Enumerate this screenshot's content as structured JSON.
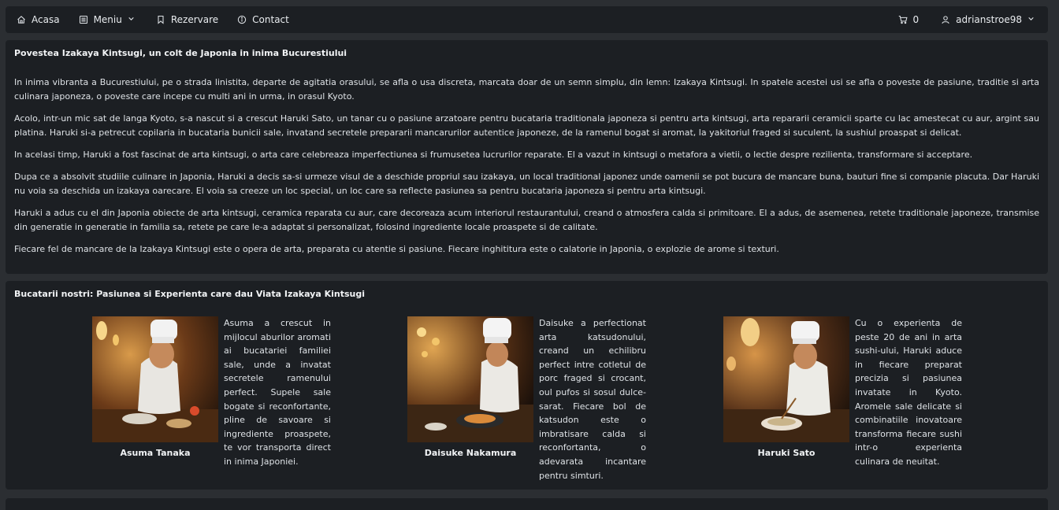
{
  "nav": {
    "home_label": "Acasa",
    "menu_label": "Meniu",
    "reservations_label": "Rezervare",
    "contact_label": "Contact",
    "cart_count": "0",
    "username": "adrianstroe98",
    "icons": [
      "home-icon",
      "menu-list-icon",
      "chevron-down-icon",
      "bookmark-icon",
      "info-icon",
      "cart-icon",
      "user-icon"
    ]
  },
  "story": {
    "title": "Povestea Izakaya Kintsugi, un colt de Japonia in inima Bucurestiului",
    "paragraphs": [
      "In inima vibranta a Bucurestiului, pe o strada linistita, departe de agitatia orasului, se afla o usa discreta, marcata doar de un semn simplu, din lemn: Izakaya Kintsugi. In spatele acestei usi se afla o poveste de pasiune, traditie si arta culinara japoneza, o poveste care incepe cu multi ani in urma, in orasul Kyoto.",
      "Acolo, intr-un mic sat de langa Kyoto, s-a nascut si a crescut Haruki Sato, un tanar cu o pasiune arzatoare pentru bucataria traditionala japoneza si pentru arta kintsugi, arta repararii ceramicii sparte cu lac amestecat cu aur, argint sau platina. Haruki si-a petrecut copilaria in bucataria bunicii sale, invatand secretele prepararii mancarurilor autentice japoneze, de la ramenul bogat si aromat, la yakitoriul fraged si suculent, la sushiul proaspat si delicat.",
      "In acelasi timp, Haruki a fost fascinat de arta kintsugi, o arta care celebreaza imperfectiunea si frumusetea lucrurilor reparate. El a vazut in kintsugi o metafora a vietii, o lectie despre rezilienta, transformare si acceptare.",
      "Dupa ce a absolvit studiile culinare in Japonia, Haruki a decis sa-si urmeze visul de a deschide propriul sau izakaya, un local traditional japonez unde oamenii se pot bucura de mancare buna, bauturi fine si companie placuta. Dar Haruki nu voia sa deschida un izakaya oarecare. El voia sa creeze un loc special, un loc care sa reflecte pasiunea sa pentru bucataria japoneza si pentru arta kintsugi.",
      "Haruki a adus cu el din Japonia obiecte de arta kintsugi, ceramica reparata cu aur, care decoreaza acum interiorul restaurantului, creand o atmosfera calda si primitoare. El a adus, de asemenea, retete traditionale japoneze, transmise din generatie in generatie in familia sa, retete pe care le-a adaptat si personalizat, folosind ingrediente locale proaspete si de calitate.",
      "Fiecare fel de mancare de la Izakaya Kintsugi este o opera de arta, preparata cu atentie si pasiune. Fiecare inghititura este o calatorie in Japonia, o explozie de arome si texturi."
    ]
  },
  "chefs": {
    "title": "Bucatarii nostri: Pasiunea si Experienta care dau Viata Izakaya Kintsugi",
    "items": [
      {
        "name": "Asuma Tanaka",
        "description": "Asuma a crescut in mijlocul aburilor aromati ai bucatariei familiei sale, unde a invatat secretele ramenului perfect. Supele sale bogate si reconfortante, pline de savoare si ingrediente proaspete, te vor transporta direct in inima Japoniei."
      },
      {
        "name": "Daisuke Nakamura",
        "description": "Daisuke a perfectionat arta katsudonului, creand un echilibru perfect intre cotletul de porc fraged si crocant, oul pufos si sosul dulce-sarat. Fiecare bol de katsudon este o imbratisare calda si reconfortanta, o adevarata incantare pentru simturi."
      },
      {
        "name": "Haruki Sato",
        "description": "Cu o experienta de peste 20 de ani in arta sushi-ului, Haruki aduce in fiecare preparat precizia si pasiunea invatate in Kyoto. Aromele sale delicate si combinatiile inovatoare transforma fiecare sushi intr-o experienta culinara de neuitat."
      }
    ]
  }
}
